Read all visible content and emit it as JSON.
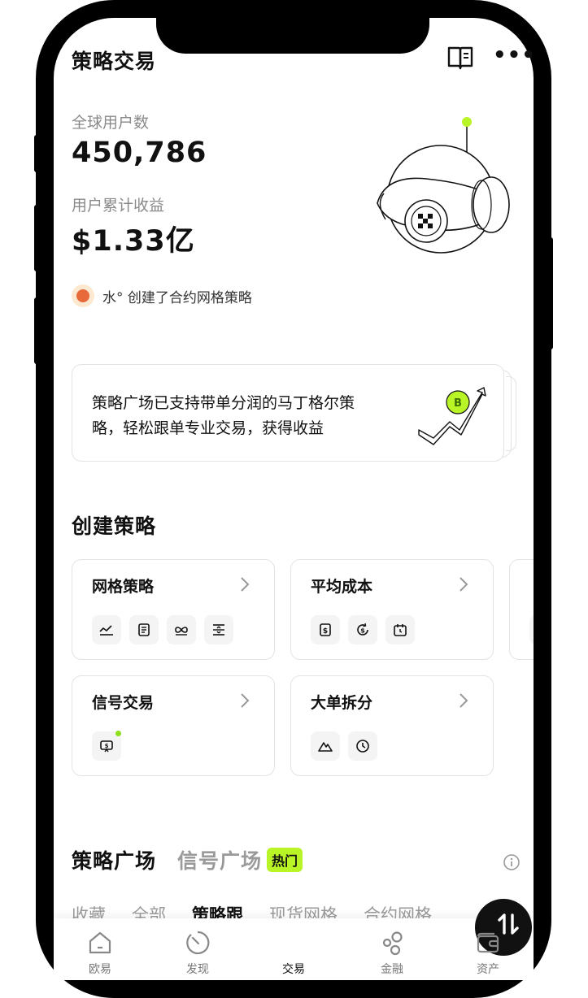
{
  "header": {
    "title": "策略交易",
    "doc_icon": "book-icon",
    "more_icon": "more-icon"
  },
  "stats": {
    "users_label": "全球用户数",
    "users_value": "450,786",
    "earnings_label": "用户累计收益",
    "earnings_value": "$1.33亿"
  },
  "activity": {
    "text": "水° 创建了合约网格策略"
  },
  "promo": {
    "text": "策略广场已支持带单分润的马丁格尔策略，轻松跟单专业交易，获得收益"
  },
  "create": {
    "title": "创建策略",
    "cards": [
      {
        "name": "网格策略",
        "icons": [
          "grid-chart-icon",
          "document-icon",
          "infinity-icon",
          "range-icon"
        ]
      },
      {
        "name": "平均成本",
        "icons": [
          "dollar-doc-icon",
          "refresh-dollar-icon",
          "calendar-icon"
        ]
      },
      {
        "name": "信号交易",
        "icons": [
          "signal-screen-icon"
        ]
      },
      {
        "name": "大单拆分",
        "icons": [
          "mountain-icon",
          "clock-icon"
        ]
      }
    ]
  },
  "plaza": {
    "tab_main": "策略广场",
    "tab_sub": "信号广场",
    "hot_badge": "热门",
    "filters": [
      "收藏",
      "全部",
      "策略跟",
      "现货网格",
      "合约网格"
    ],
    "active_filter": "策略跟"
  },
  "nav": {
    "items": [
      {
        "label": "欧易",
        "icon": "home-icon"
      },
      {
        "label": "发现",
        "icon": "compass-icon"
      },
      {
        "label": "交易",
        "icon": "trade-swap-icon"
      },
      {
        "label": "金融",
        "icon": "bubbles-icon"
      },
      {
        "label": "资产",
        "icon": "wallet-icon"
      }
    ]
  },
  "colors": {
    "accent": "#b9f427",
    "text": "#111111",
    "muted": "#8a8a8a",
    "border": "#e3e3e3"
  }
}
